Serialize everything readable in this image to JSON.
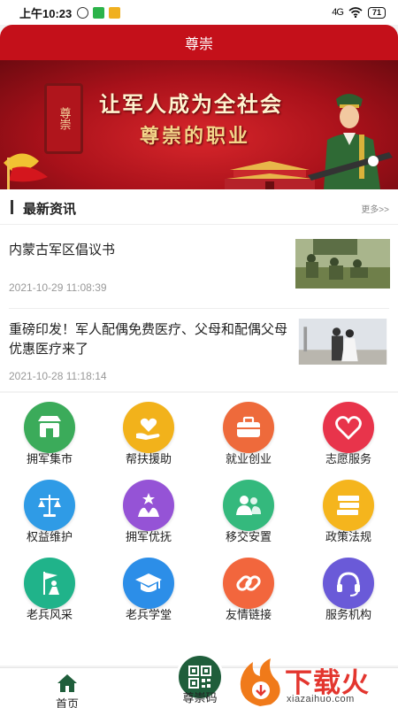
{
  "status_bar": {
    "time": "上午10:23",
    "battery": "71",
    "network": "4G"
  },
  "header": {
    "title": "尊崇"
  },
  "banner": {
    "seal_text": "尊崇",
    "line1": "让军人成为全社会",
    "line2": "尊崇的职业"
  },
  "news": {
    "section_title": "最新资讯",
    "more_label": "更多>>",
    "articles": [
      {
        "title": "内蒙古军区倡议书",
        "date": "2021-10-29 11:08:39"
      },
      {
        "title": "重磅印发！军人配偶免费医疗、父母和配偶父母优惠医疗来了",
        "date": "2021-10-28 11:18:14"
      }
    ]
  },
  "services": [
    {
      "label": "拥军集市",
      "icon": "store-icon",
      "color": "#3bab5a"
    },
    {
      "label": "帮扶援助",
      "icon": "heart-hand-icon",
      "color": "#f2b21b"
    },
    {
      "label": "就业创业",
      "icon": "briefcase-icon",
      "color": "#ee6a3b"
    },
    {
      "label": "志愿服务",
      "icon": "heart-icon",
      "color": "#e8344b"
    },
    {
      "label": "权益维护",
      "icon": "scales-icon",
      "color": "#2f9be6"
    },
    {
      "label": "拥军优抚",
      "icon": "star-people-icon",
      "color": "#9553d6"
    },
    {
      "label": "移交安置",
      "icon": "people-icon",
      "color": "#34b97d"
    },
    {
      "label": "政策法规",
      "icon": "books-icon",
      "color": "#f5b51d"
    },
    {
      "label": "老兵风采",
      "icon": "flag-person-icon",
      "color": "#20b38a"
    },
    {
      "label": "老兵学堂",
      "icon": "graduation-cap-icon",
      "color": "#2c8ee8"
    },
    {
      "label": "友情链接",
      "icon": "link-icon",
      "color": "#f2663d"
    },
    {
      "label": "服务机构",
      "icon": "headset-icon",
      "color": "#6a5ad8"
    }
  ],
  "bottom_nav": {
    "home_label": "首页",
    "qr_label": "尊崇码"
  },
  "watermark": {
    "text": "下载火",
    "sub": "xiazaihuo.com"
  },
  "colors": {
    "brand_red": "#c4101a",
    "qr_green": "#1f5e3b"
  }
}
